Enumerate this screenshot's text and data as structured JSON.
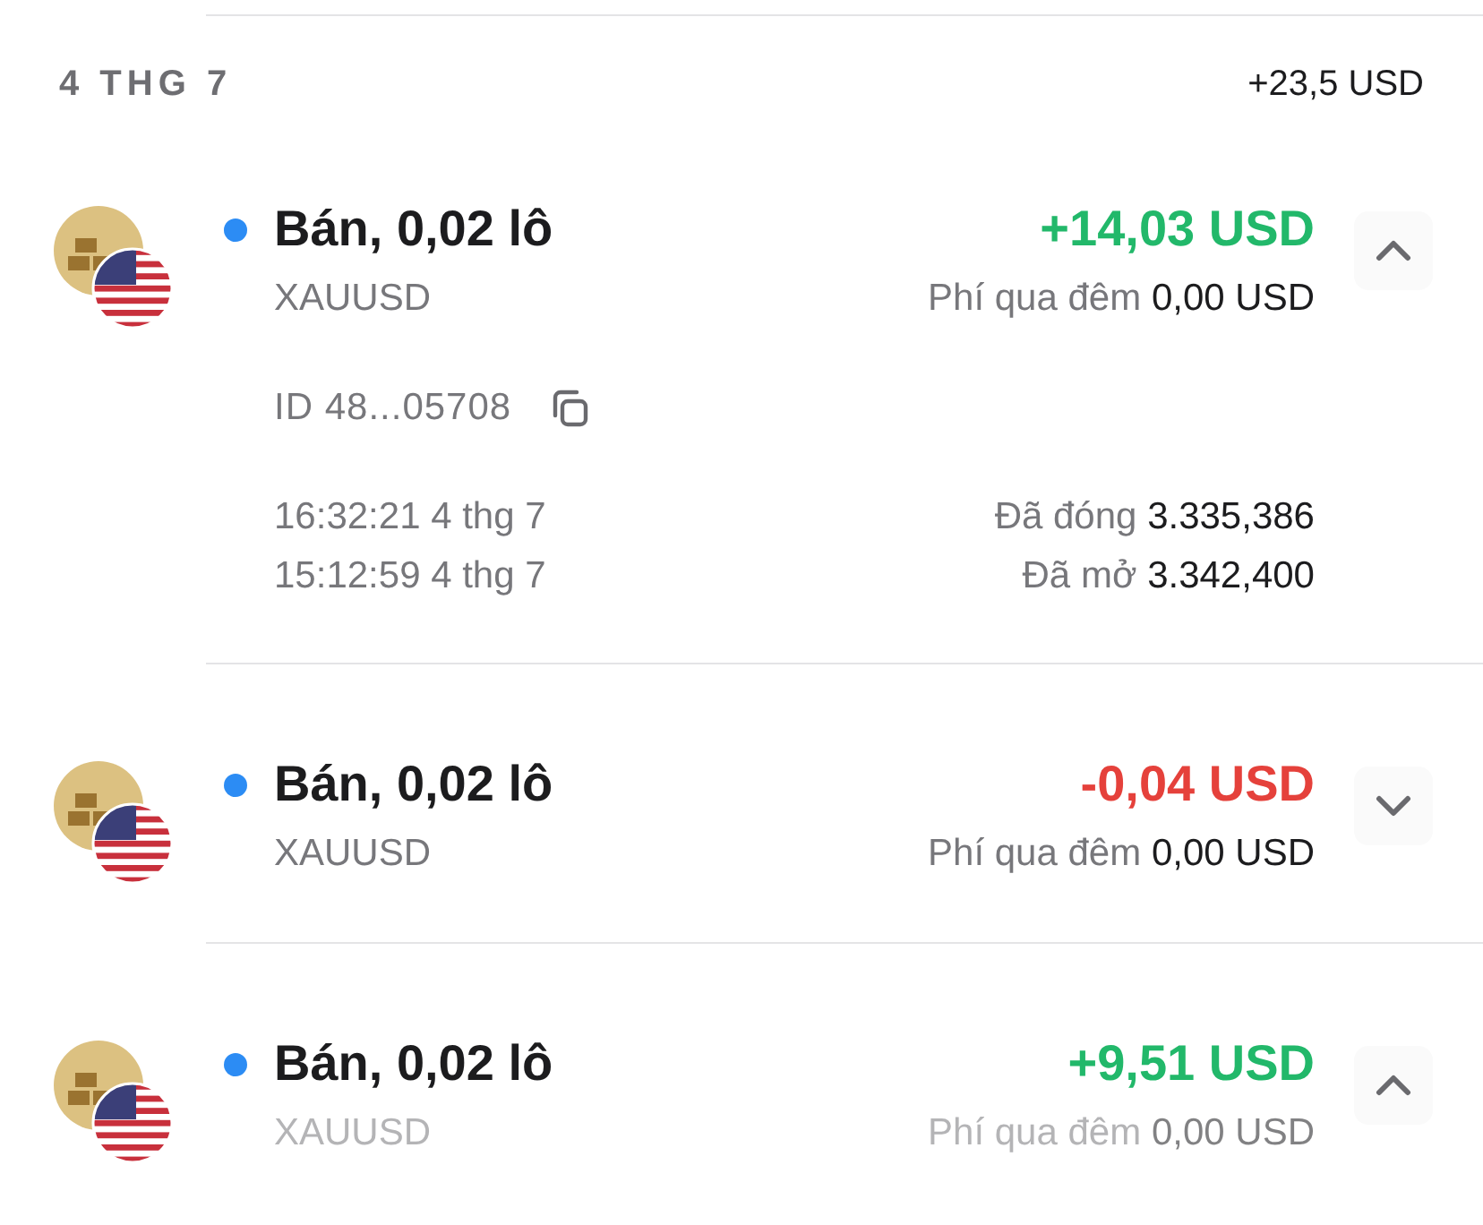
{
  "day": {
    "date": "4 THG 7",
    "total": "+23,5 USD"
  },
  "trades": [
    {
      "title": "Bán, 0,02 lô",
      "symbol": "XAUUSD",
      "pnl": "+14,03 USD",
      "color": "#22b86a",
      "fee_label": "Phí qua đêm",
      "fee_value": "0,00 USD",
      "expanded": true,
      "dimmed": false,
      "details": {
        "id": "ID 48...05708",
        "closed_time": "16:32:21 4 thg 7",
        "closed_label": "Đã đóng",
        "closed_price": "3.335,386",
        "opened_time": "15:12:59 4 thg 7",
        "opened_label": "Đã mở",
        "opened_price": "3.342,400"
      }
    },
    {
      "title": "Bán, 0,02 lô",
      "symbol": "XAUUSD",
      "pnl": "-0,04 USD",
      "color": "#e5413b",
      "fee_label": "Phí qua đêm",
      "fee_value": "0,00 USD",
      "expanded": false,
      "dimmed": false
    },
    {
      "title": "Bán, 0,02 lô",
      "symbol": "XAUUSD",
      "pnl": "+9,51 USD",
      "color": "#22b86a",
      "fee_label": "Phí qua đêm",
      "fee_value": "0,00 USD",
      "expanded": true,
      "dimmed": true
    }
  ]
}
